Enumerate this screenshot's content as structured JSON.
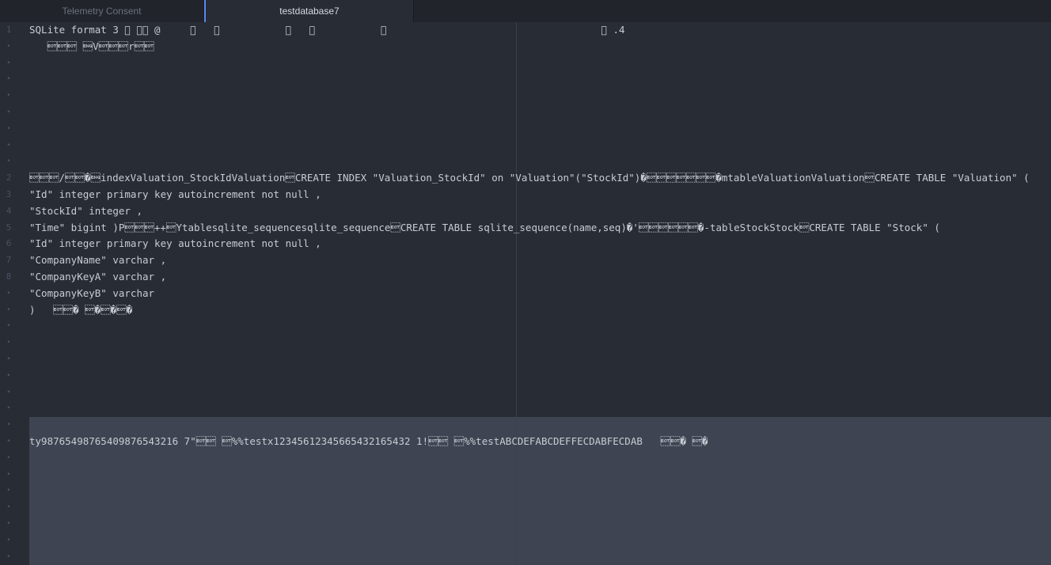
{
  "tabs": [
    {
      "label": "Telemetry Consent",
      "active": false
    },
    {
      "label": "testdatabase7",
      "active": true
    }
  ],
  "gutter": [
    "1",
    "•",
    "•",
    "•",
    "•",
    "•",
    "•",
    "•",
    "•",
    "2",
    "3",
    "4",
    "5",
    "6",
    "7",
    "8",
    "•",
    "•",
    "•",
    "•",
    "•",
    "•",
    "•",
    "•",
    "•",
    "•",
    "•",
    "•",
    "•",
    "•",
    "•",
    "•",
    "•"
  ],
  "lines": [
    "SQLite format 3 \u0000 \u0010\u0000 @     \u0001   \u0001           \u0001   \u0001           \u0001                                    \u0001 .4",
    "   \u0004\u0004\u0004 \u0005V\u0004\u0004\u0004r\u0004\u0004",
    "",
    "",
    "",
    "",
    "",
    "",
    "",
    "\u0004\u0004\u0004/\u0004\u0004�\u0005indexValuation_StockIdValuation\u0004CREATE INDEX \"Valuation_StockId\" on \"Valuation\"(\"StockId\")�\u0004\u0004\u0004\u0004\u0004\u0004\u0004�mtableValuationValuation\u0004CREATE TABLE \"Valuation\" (",
    "\"Id\" integer primary key autoincrement not null ,",
    "\"StockId\" integer ,",
    "\"Time\" bigint )P\u0004\u0004\u0004++\u0004Ytablesqlite_sequencesqlite_sequence\u0004CREATE TABLE sqlite_sequence(name,seq)�'\u0004\u0004\u0004\u0004\u0004\u0004�-tableStockStock\u0004CREATE TABLE \"Stock\" (",
    "\"Id\" integer primary key autoincrement not null ,",
    "\"CompanyName\" varchar ,",
    "\"CompanyKeyA\" varchar ,",
    "\"CompanyKeyB\" varchar",
    ")   \u0004\u0004� \u0004�\u0004�\u0004�",
    "",
    "",
    "",
    "",
    "",
    "",
    "",
    "ty98765498765409876543216 7\"\u0004\u0004 \u0004%%testx12345612345665432165432 1!\u0004\u0004 \u0004%%testABCDEFABCDEFFECDABFECDAB   \u0004\u0004� \u0004�",
    "",
    "",
    "",
    "",
    "",
    "",
    ""
  ]
}
